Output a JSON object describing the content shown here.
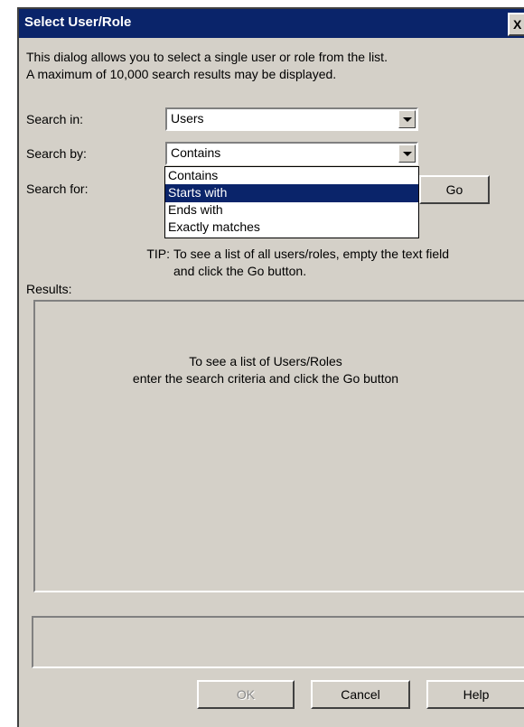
{
  "dialog": {
    "title": "Select User/Role",
    "close_label": "X",
    "description_line1": "This dialog allows you to select a single user or role from the list.",
    "description_line2": "A maximum of 10,000 search results may be displayed."
  },
  "form": {
    "search_in_label": "Search in:",
    "search_in_value": "Users",
    "search_by_label": "Search by:",
    "search_by_value": "Contains",
    "search_for_label": "Search for:",
    "go_label": "Go"
  },
  "dropdown": {
    "options": [
      "Contains",
      "Starts with",
      "Ends with",
      "Exactly matches"
    ],
    "highlighted": "Starts with"
  },
  "tip": {
    "key": "TIP:",
    "line1": "To see a list of all users/roles, empty the text field",
    "line2": "and click the Go button."
  },
  "results": {
    "label": "Results:",
    "message_line1": "To see a list of Users/Roles",
    "message_line2": "enter the search criteria and click the Go button"
  },
  "buttons": {
    "ok_label": "OK",
    "cancel_label": "Cancel",
    "help_label": "Help"
  },
  "colors": {
    "titlebar": "#0a246a",
    "dialog_bg": "#d4d0c8",
    "selection": "#0a246a"
  }
}
